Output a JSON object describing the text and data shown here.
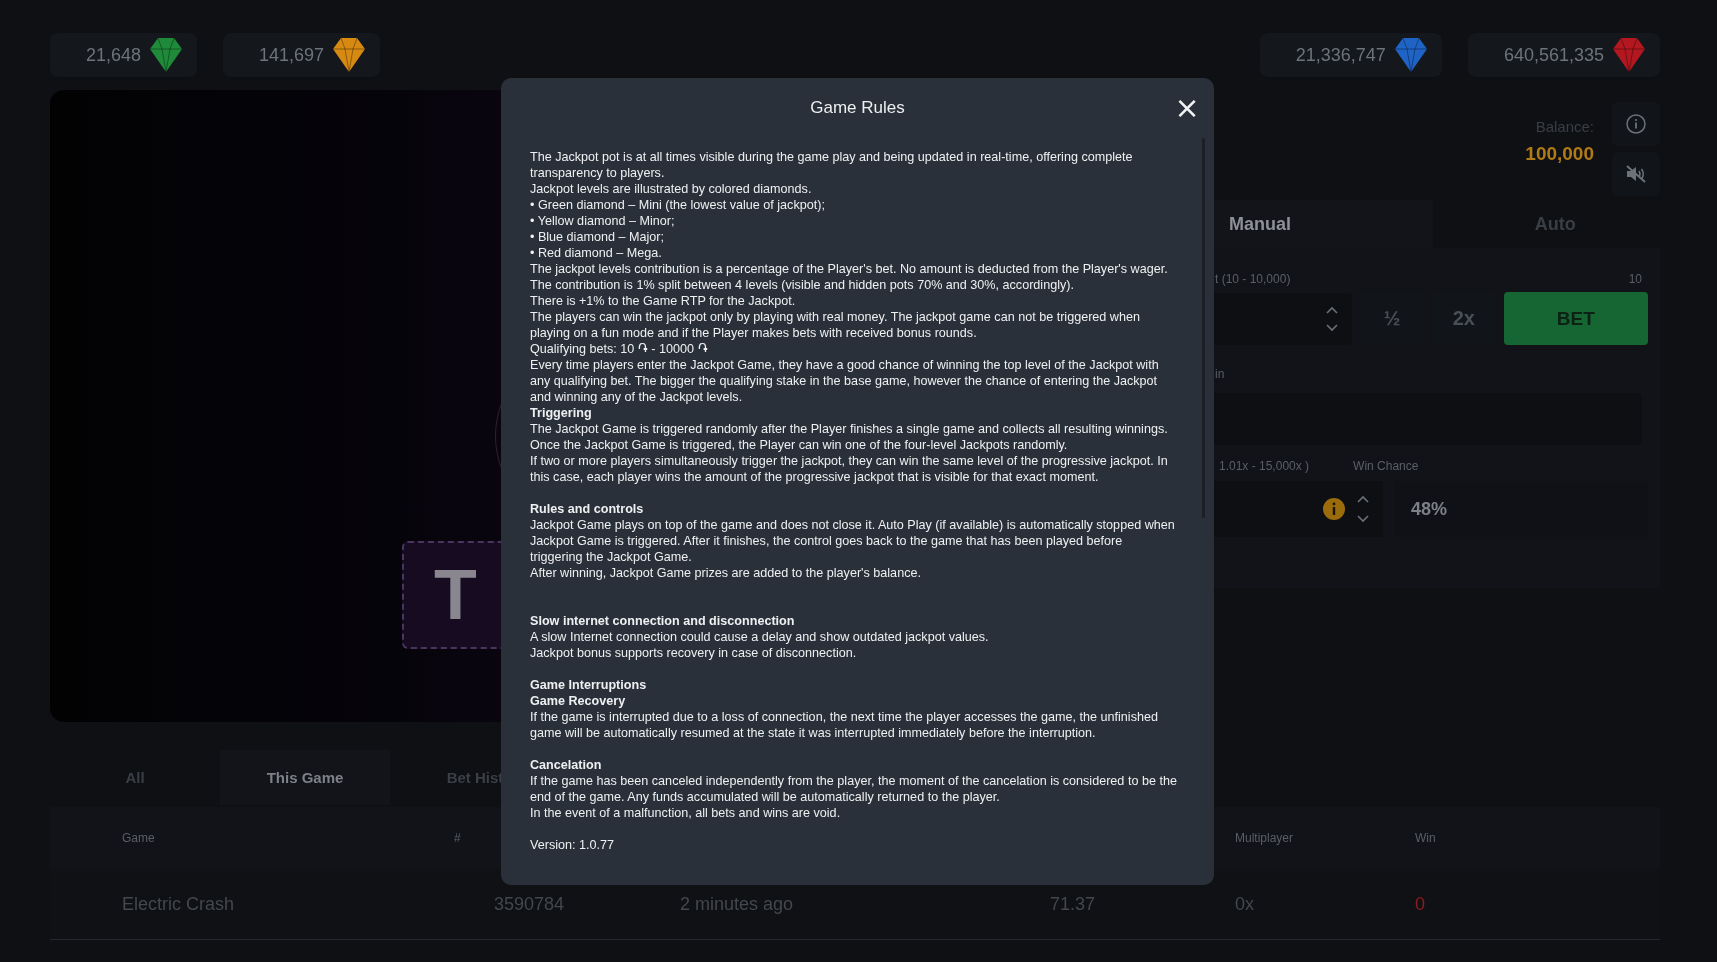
{
  "jackpots_left": [
    {
      "value": "21,648",
      "color": "#1f8a3a"
    },
    {
      "value": "141,697",
      "color": "#d68a12"
    }
  ],
  "jackpots_right": [
    {
      "value": "21,336,747",
      "color": "#1f63c4"
    },
    {
      "value": "640,561,335",
      "color": "#b3171f"
    }
  ],
  "game": {
    "button_text": "T"
  },
  "balance": {
    "label": "Balance:",
    "value": "100,000"
  },
  "mode_tabs": [
    {
      "label": "Manual",
      "selected": true
    },
    {
      "label": "Auto",
      "selected": false
    }
  ],
  "bet": {
    "label": "t (10 - 10,000)",
    "max": "10",
    "half": "½",
    "double": "2x",
    "button": "BET"
  },
  "win": {
    "label": "in"
  },
  "multiplier": {
    "label": "1.01x - 15,000x )",
    "chance_label": "Win Chance",
    "chance": "48%"
  },
  "history_tabs": [
    {
      "label": "All",
      "selected": false
    },
    {
      "label": "This Game",
      "selected": true
    },
    {
      "label": "Bet Hist",
      "selected": false
    }
  ],
  "table": {
    "header": [
      {
        "label": "Game"
      },
      {
        "label": "#"
      },
      {
        "label": "Multiplayer"
      },
      {
        "label": "Win"
      }
    ],
    "rows": [
      {
        "cells": [
          "Electric Crash",
          "3590784",
          "2 minutes ago",
          "71.37",
          "0x",
          "0"
        ]
      }
    ]
  },
  "modal": {
    "title": "Game Rules",
    "close": "×",
    "body": [
      {
        "kind": "text",
        "text": "The Jackpot pot is at all times visible during the game play and being updated in real-time, offering complete transparency to players."
      },
      {
        "kind": "text",
        "text": "Jackpot levels are illustrated by colored diamonds."
      },
      {
        "kind": "text",
        "text": "• Green diamond – Mini (the lowest value of jackpot);"
      },
      {
        "kind": "text",
        "text": "• Yellow diamond – Minor;"
      },
      {
        "kind": "text",
        "text": "• Blue diamond – Major;"
      },
      {
        "kind": "text",
        "text": "• Red diamond – Mega."
      },
      {
        "kind": "text",
        "text": "The jackpot levels contribution is a percentage of the Player's bet. No amount is deducted from the Player's wager. The contribution is 1% split between 4 levels (visible and hidden pots 70% and 30%, accordingly)."
      },
      {
        "kind": "text",
        "text": "There is +1% to the Game RTP for the Jackpot."
      },
      {
        "kind": "text",
        "text": "The players can win the jackpot only by playing with real money. The jackpot game can not be triggered when playing on a fun mode and if the Player makes bets with received bonus rounds."
      },
      {
        "kind": "text",
        "text": "Qualifying bets: 10 ֏ - 10000 ֏"
      },
      {
        "kind": "text",
        "text": "Every time players enter the Jackpot Game, they have a good chance of winning the top level of the Jackpot with any qualifying bet. The bigger the qualifying stake in the base game, however the chance of entering the Jackpot and winning any of the Jackpot levels."
      },
      {
        "kind": "heading",
        "text": "Triggering"
      },
      {
        "kind": "text",
        "text": "The Jackpot Game is triggered randomly after the Player finishes a single game and collects all resulting winnings. Once the Jackpot Game is triggered, the Player can win one of the four-level Jackpots randomly."
      },
      {
        "kind": "text",
        "text": "If two or more players simultaneously trigger the jackpot, they can win the same level of the progressive jackpot. In this case, each player wins the amount of the progressive jackpot that is visible for that exact moment."
      },
      {
        "kind": "blank"
      },
      {
        "kind": "heading",
        "text": "Rules and controls"
      },
      {
        "kind": "text",
        "text": "Jackpot Game plays on top of the game and does not close it. Auto Play (if available) is automatically stopped when Jackpot Game is triggered. After it finishes, the control goes back to the game that has been played before triggering the Jackpot Game."
      },
      {
        "kind": "text",
        "text": "After winning, Jackpot Game prizes are added to the player's balance."
      },
      {
        "kind": "blank"
      },
      {
        "kind": "blank"
      },
      {
        "kind": "heading",
        "text": "Slow internet connection and disconnection"
      },
      {
        "kind": "text",
        "text": "A slow Internet connection could cause a delay and show outdated jackpot values."
      },
      {
        "kind": "text",
        "text": "Jackpot bonus supports recovery in case of disconnection."
      },
      {
        "kind": "blank"
      },
      {
        "kind": "heading",
        "text": "Game Interruptions"
      },
      {
        "kind": "heading",
        "text": "Game Recovery"
      },
      {
        "kind": "text",
        "text": "If the game is interrupted due to a loss of connection, the next time the player accesses the game, the unfinished game will be automatically resumed at the state it was interrupted immediately before the interruption."
      },
      {
        "kind": "blank"
      },
      {
        "kind": "heading",
        "text": "Cancelation"
      },
      {
        "kind": "text",
        "text": "If the game has been canceled independently from the player, the moment of the cancelation is considered to be the end of the game. Any funds accumulated will be automatically returned to the player."
      },
      {
        "kind": "text",
        "text": "In the event of a malfunction, all bets and wins are void."
      },
      {
        "kind": "blank"
      },
      {
        "kind": "text",
        "text": "Version: 1.0.77"
      }
    ]
  }
}
